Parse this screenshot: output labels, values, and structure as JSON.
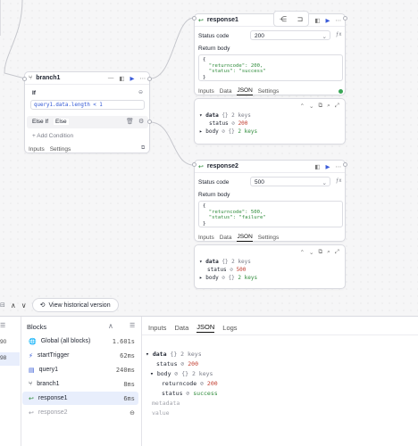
{
  "colors": {
    "accent": "#2f55d4",
    "success": "#2e8b3a",
    "number": "#c0392b",
    "highlight": "#e8eefc"
  },
  "branch_node": {
    "title": "branch1",
    "if_label": "If",
    "condition": "query1.data.length < 1",
    "else_if_label": "Else If",
    "else_label": "Else",
    "add_condition": "Add Condition",
    "tabs": [
      "Inputs",
      "Settings"
    ]
  },
  "response1": {
    "title": "response1",
    "status_code_label": "Status code",
    "status_code_value": "200",
    "return_body_label": "Return body",
    "return_body_lines": [
      "{",
      "  \"returncode\": 200,",
      "  \"status\": \"success\"",
      "}"
    ],
    "tabs": [
      "Inputs",
      "Data",
      "JSON",
      "Settings"
    ],
    "active_tab": "JSON",
    "output": {
      "data_key": "data",
      "data_info": "2 keys",
      "status_key": "status",
      "status_value": "200",
      "body_key": "body",
      "body_info": "2 keys"
    }
  },
  "response2": {
    "title": "response2",
    "status_code_label": "Status code",
    "status_code_value": "500",
    "return_body_label": "Return body",
    "return_body_lines": [
      "{",
      "  \"returncode\": 500,",
      "  \"status\": \"failure\"",
      "}"
    ],
    "tabs": [
      "Inputs",
      "Data",
      "JSON",
      "Settings"
    ],
    "active_tab": "JSON",
    "output": {
      "data_key": "data",
      "data_info": "2 keys",
      "status_key": "status",
      "status_value": "500",
      "body_key": "body",
      "body_info": "2 keys"
    }
  },
  "toolbar": {
    "historical_button": "View historical version"
  },
  "blocks_panel": {
    "title": "Blocks",
    "items": [
      {
        "name": "Global (all blocks)",
        "time": "1.601s",
        "icon": "globe-icon"
      },
      {
        "name": "startTrigger",
        "time": "62ms",
        "icon": "trigger-icon"
      },
      {
        "name": "query1",
        "time": "240ms",
        "icon": "database-icon"
      },
      {
        "name": "branch1",
        "time": "8ms",
        "icon": "branch-icon"
      },
      {
        "name": "response1",
        "time": "6ms",
        "icon": "response-icon"
      },
      {
        "name": "response2",
        "time": "",
        "icon": "response-icon"
      }
    ],
    "left_numbers": [
      "90",
      "98"
    ]
  },
  "detail_panel": {
    "tabs": [
      "Inputs",
      "Data",
      "JSON",
      "Logs"
    ],
    "active_tab": "JSON",
    "data_key": "data",
    "data_info": "2 keys",
    "status_key": "status",
    "status_value": "200",
    "body_key": "body",
    "body_info": "2 keys",
    "returncode_key": "returncode",
    "returncode_value": "200",
    "body_status_key": "status",
    "body_status_value": "success",
    "metadata_label": "metadata",
    "value_label": "value"
  }
}
